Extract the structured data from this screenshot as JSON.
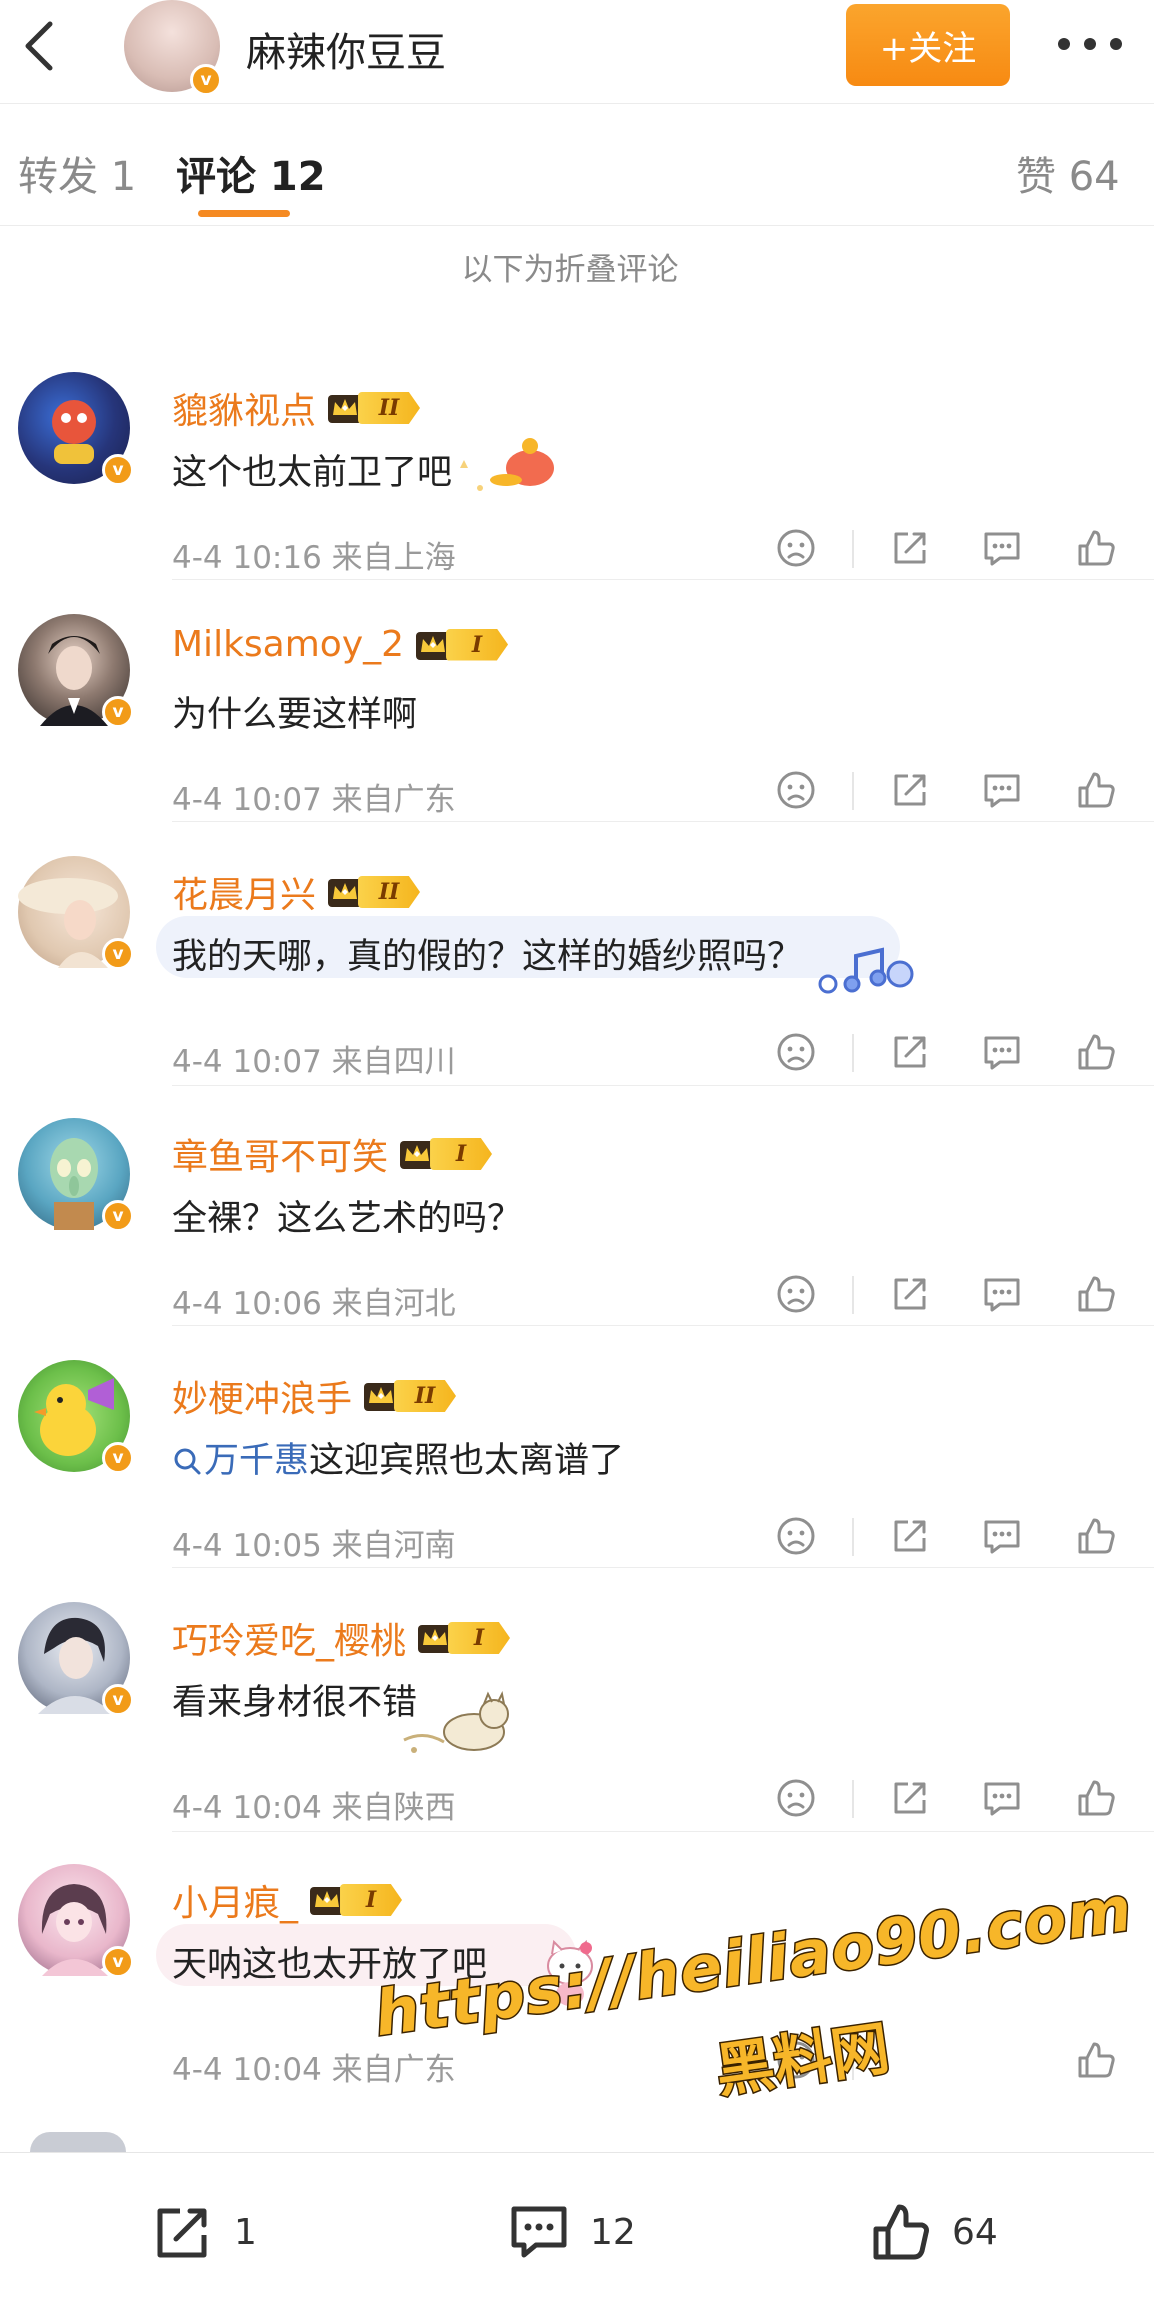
{
  "header": {
    "title": "麻辣你豆豆",
    "follow_label": "+关注",
    "verified_glyph": "v"
  },
  "tabs": {
    "repost": "转发 1",
    "comments": "评论 12",
    "likes": "赞 64"
  },
  "folded_notice": "以下为折叠评论",
  "comments": [
    {
      "name": "貔貅视点",
      "level": "II",
      "text": "这个也太前卫了吧",
      "meta": "4-4 10:16 来自上海",
      "avatar": "cartoon-avatar"
    },
    {
      "name": "Milksamoy_2",
      "level": "I",
      "text": "为什么要这样啊",
      "meta": "4-4 10:07 来自广东",
      "avatar": "man-avatar"
    },
    {
      "name": "花晨月兴",
      "level": "II",
      "text": "我的天哪，真的假的？这样的婚纱照吗？",
      "meta": "4-4 10:07 来自四川",
      "avatar": "woman-hat-avatar"
    },
    {
      "name": "章鱼哥不可笑",
      "level": "I",
      "text": "全裸？这么艺术的吗？",
      "meta": "4-4 10:06 来自河北",
      "avatar": "squidward-avatar"
    },
    {
      "name": "妙梗冲浪手",
      "level": "II",
      "topic": "万千惠",
      "text": "这迎宾照也太离谱了",
      "meta": "4-4 10:05 来自河南",
      "avatar": "duck-avatar"
    },
    {
      "name": "巧玲爱吃_樱桃",
      "level": "I",
      "text": "看来身材很不错",
      "meta": "4-4 10:04 来自陕西",
      "avatar": "anime-man-avatar"
    },
    {
      "name": "小月痕_",
      "level": "I",
      "text": "天呐这也太开放了吧",
      "meta": "4-4 10:04 来自广东",
      "avatar": "anime-girl-avatar"
    }
  ],
  "watermark": {
    "url": "https://heiliao90.com",
    "name": "黑料网"
  },
  "bottom_bar": {
    "repost_count": "1",
    "comment_count": "12",
    "like_count": "64"
  },
  "colors": {
    "accent": "#f78a12",
    "username": "#eb7a1c",
    "topic": "#3a6bb8",
    "meta": "#9a9a9a"
  }
}
